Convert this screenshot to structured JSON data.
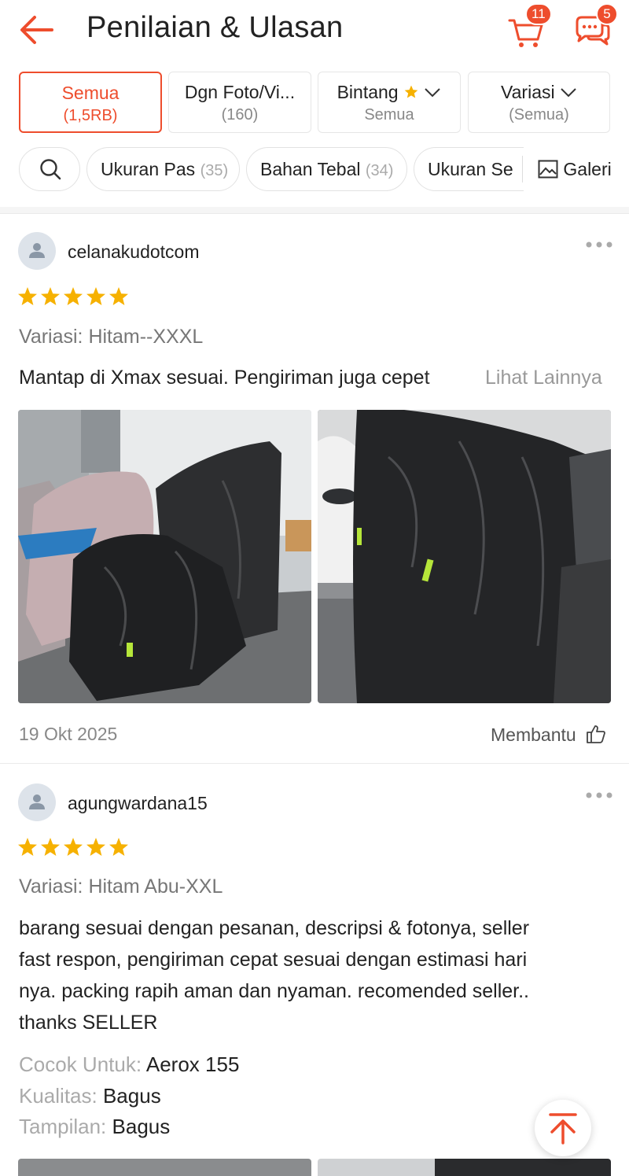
{
  "header": {
    "title": "Penilaian & Ulasan",
    "cart_badge": "11",
    "chat_badge": "5",
    "accent_color": "#ee4d2d"
  },
  "filters": [
    {
      "label": "Semua",
      "sub": "(1,5RB)",
      "active": true
    },
    {
      "label": "Dgn Foto/Vi...",
      "sub": "(160)",
      "active": false
    },
    {
      "label": "Bintang",
      "sub": "Semua",
      "active": false
    },
    {
      "label": "Variasi",
      "sub": "(Semua)",
      "active": false
    }
  ],
  "chips": [
    {
      "label": "Ukuran Pas",
      "count": "(35)"
    },
    {
      "label": "Bahan Tebal",
      "count": "(34)"
    },
    {
      "label": "Ukuran Se",
      "count": ""
    }
  ],
  "gallery_label": "Galeri",
  "reviews": [
    {
      "user": "celanakudotcom",
      "rating": 5,
      "variant": "Variasi: Hitam--XXXL",
      "text": "Mantap di Xmax sesuai. Pengiriman juga cepet",
      "more": "Lihat Lainnya",
      "date": "19 Okt 2025",
      "helpful": "Membantu"
    },
    {
      "user": "agungwardana15",
      "rating": 5,
      "variant": "Variasi: Hitam Abu-XXL",
      "text_lines": [
        "barang sesuai dengan pesanan, descripsi & fotonya, seller",
        "fast respon, pengiriman cepat sesuai dengan estimasi hari",
        "nya. packing rapih aman dan nyaman. recomended seller..",
        "thanks SELLER"
      ],
      "attributes": [
        {
          "key": "Cocok Untuk:",
          "value": "Aerox 155"
        },
        {
          "key": "Kualitas:",
          "value": "Bagus"
        },
        {
          "key": "Tampilan:",
          "value": "Bagus"
        }
      ]
    }
  ]
}
